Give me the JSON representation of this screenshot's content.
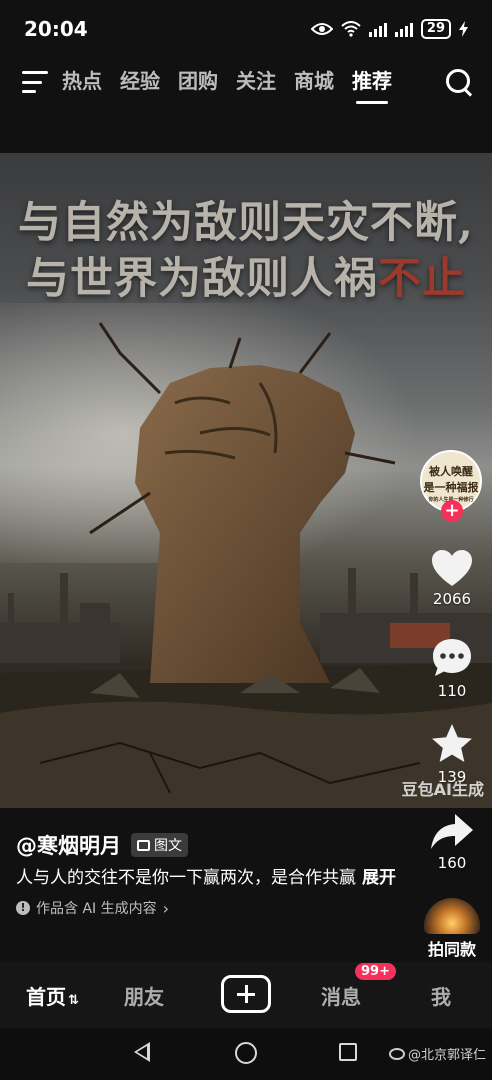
{
  "status_bar": {
    "time": "20:04",
    "battery": "29",
    "network_label": "6"
  },
  "top_nav": {
    "tabs": [
      {
        "label": "热点",
        "active": false
      },
      {
        "label": "经验",
        "active": false
      },
      {
        "label": "团购",
        "active": false
      },
      {
        "label": "关注",
        "active": false
      },
      {
        "label": "商城",
        "active": false
      },
      {
        "label": "推荐",
        "active": true
      }
    ]
  },
  "post": {
    "headline_line1": "与自然为敌则天灾不断,",
    "headline_line2_main": "与世界为敌则人祸",
    "headline_line2_red": "不止",
    "image_watermark": "豆包AI生成",
    "author": "@寒烟明月",
    "type_badge": "图文",
    "description": "人与人的交往不是你一下赢两次，是合作共赢",
    "expand_label": "展开",
    "ai_note": "作品含 AI 生成内容"
  },
  "rail": {
    "avatar_text_line1": "被人唤醒",
    "avatar_text_line2": "是一种福报",
    "avatar_text_line3": "你的人生是一种修行",
    "like_count": "2066",
    "comment_count": "110",
    "favorite_count": "139",
    "share_count": "160",
    "same_style_label": "拍同款"
  },
  "bottom_nav": {
    "home_label": "首页",
    "friends_label": "朋友",
    "messages_label": "消息",
    "messages_badge": "99+",
    "me_label": "我"
  },
  "watermark": "@北京郭译仁",
  "colors": {
    "accent": "#f5305a",
    "headline": "#b7b3aa",
    "headline_red": "#9b3a2c"
  }
}
